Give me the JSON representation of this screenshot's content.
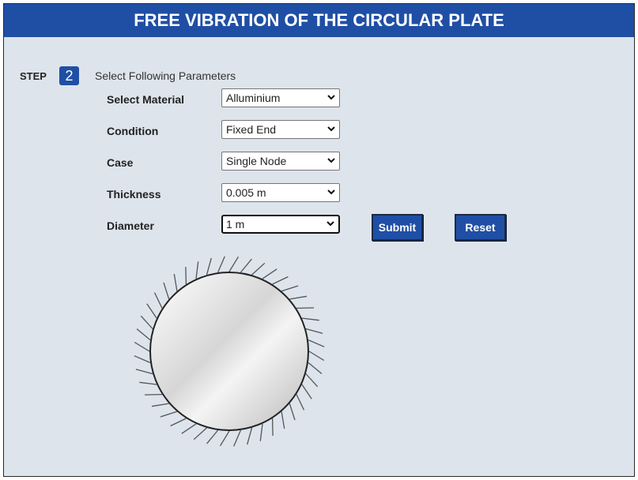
{
  "header": {
    "title": "FREE VIBRATION OF THE CIRCULAR PLATE"
  },
  "step": {
    "label": "STEP",
    "number": "2",
    "description": "Select Following Parameters"
  },
  "params": {
    "material": {
      "label": "Select Material",
      "value": "Alluminium"
    },
    "condition": {
      "label": "Condition",
      "value": "Fixed End"
    },
    "case": {
      "label": "Case",
      "value": "Single Node"
    },
    "thickness": {
      "label": "Thickness",
      "value": "0.005 m"
    },
    "diameter": {
      "label": "Diameter",
      "value": "1 m"
    }
  },
  "buttons": {
    "submit": "Submit",
    "reset": "Reset"
  },
  "colors": {
    "header_bg": "#1f4fa5",
    "panel_bg": "#dde4ec",
    "button_bg": "#1f4fa5"
  },
  "icons": {
    "dropdown": "chevron-down-icon",
    "plate": "fixed-circular-plate-icon"
  }
}
